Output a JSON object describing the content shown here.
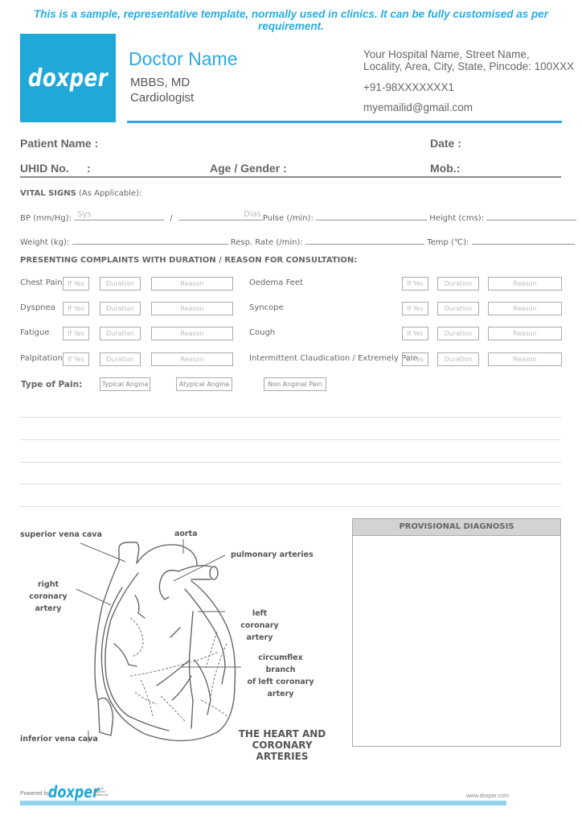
{
  "banner": "This is a sample, representative template, normally used in clinics. It can be fully customised as per requirement.",
  "logo": {
    "text": "doxper",
    "color": "#1fa8d8"
  },
  "doctor": {
    "name": "Doctor Name",
    "degree": "MBBS, MD",
    "specialty": "Cardiologist"
  },
  "hospital": {
    "line1": "Your Hospital Name, Street Name,",
    "line2": "Locality, Area, City, State, Pincode: 100XXX",
    "phone": "+91-98XXXXXXX1",
    "email": "myemailid@gmail.com"
  },
  "patient": {
    "name_label": "Patient Name :",
    "date_label": "Date :",
    "uhid_label": "UHID No.",
    "uhid_colon": ":",
    "age_gender_label": "Age / Gender :",
    "mob_label": "Mob.:"
  },
  "vitals": {
    "title_bold": "VITAL SIGNS",
    "title_rest": " (As Applicable):",
    "bp_label": "BP (mm/Hg):",
    "bp_sys_placeholder": "Sys",
    "bp_sep": "/",
    "bp_dias_placeholder": "Dias",
    "pulse_label": "Pulse (/min):",
    "height_label": "Height (cms):",
    "weight_label": "Weight (kg):",
    "resp_label": "Resp. Rate (/min):",
    "temp_label": "Temp (℃):"
  },
  "complaints": {
    "title": "PRESENTING COMPLAINTS WITH DURATION / REASON FOR CONSULTATION:",
    "placeholders": {
      "if_yes": "If Yes",
      "duration": "Duration",
      "reason": "Reason"
    },
    "left": [
      "Chest Pain",
      "Dyspnea",
      "Fatigue",
      "Palpitation"
    ],
    "right": [
      "Oedema Feet",
      "Syncope",
      "Cough",
      "Intermittent Claudication / Extremely Pain"
    ]
  },
  "pain": {
    "label": "Type of Pain:",
    "options": [
      "Typical Angina",
      "Atypical Angina",
      "Non Anginal Pain"
    ]
  },
  "diagnosis": {
    "title": "PROVISIONAL DIAGNOSIS"
  },
  "heart": {
    "labels": {
      "svc": "superior vena cava",
      "aorta": "aorta",
      "pulmonary": "pulmonary arteries",
      "rca1": "right coronary",
      "rca2": "artery",
      "lca1": "left coronary",
      "lca2": "artery",
      "circ1": "circumflex branch",
      "circ2": "of left coronary",
      "circ3": "artery",
      "ivc": "inferior vena cava"
    },
    "title1": "THE HEART AND",
    "title2": "CORONARY ARTERIES"
  },
  "footer": {
    "powered_by": "Powered by",
    "logo": "doxper",
    "tagline1": "Instant",
    "tagline2": "Digitized",
    "tagline3": "Healthcare",
    "website": "www.doxper.com"
  }
}
